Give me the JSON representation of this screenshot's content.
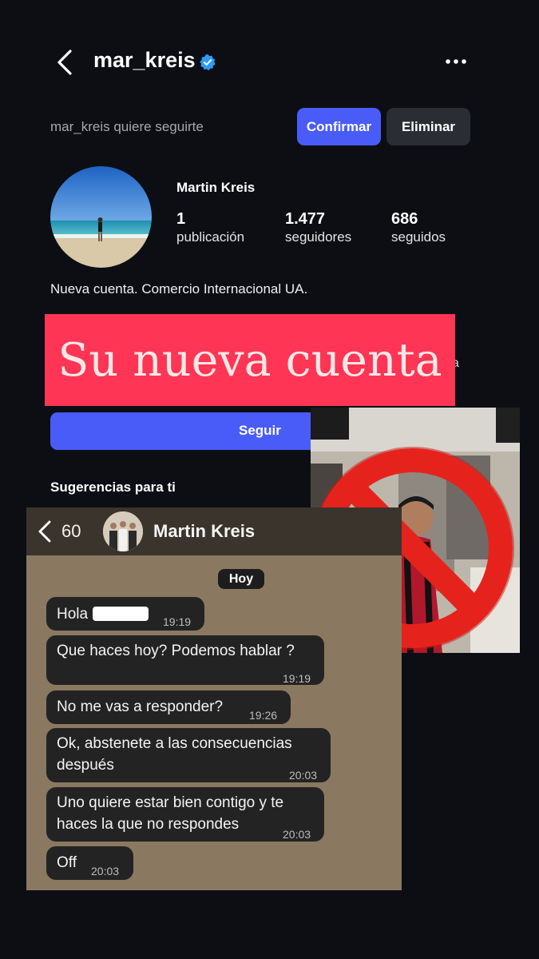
{
  "profile_request": {
    "username": "mar_kreis",
    "request_text": "mar_kreis quiere seguirte",
    "confirm_label": "Confirmar",
    "delete_label": "Eliminar"
  },
  "profile": {
    "full_name": "Martin Kreis",
    "stats": [
      {
        "value": "1",
        "label": "publicación"
      },
      {
        "value": "1.477",
        "label": "seguidores"
      },
      {
        "value": "686",
        "label": "seguidos"
      }
    ],
    "bio": "Nueva cuenta. Comercio Internacional UA.",
    "follow_label": "Seguir",
    "suggestions_label": "Sugerencias para ti",
    "partial_text": "a"
  },
  "banner": {
    "text": "Su nueva cuenta"
  },
  "chat": {
    "back_count": "60",
    "contact_name": "Martin Kreis",
    "day_label": "Hoy",
    "messages": [
      {
        "text": "Hola",
        "time": "19:19"
      },
      {
        "text": "Que haces hoy? Podemos hablar ?",
        "time": "19:19"
      },
      {
        "text": "No me vas a responder?",
        "time": "19:26"
      },
      {
        "line1": "Ok, abstenete a las consecuencias",
        "line2": "después",
        "time": "20:03"
      },
      {
        "line1": "Uno quiere estar bien contigo y te",
        "line2": "haces la que no respondes",
        "time": "20:03"
      },
      {
        "text": "Off",
        "time": "20:03"
      }
    ]
  },
  "colors": {
    "background": "#0c0e14",
    "primary_button": "#4a5cf7",
    "secondary_button": "#2a2d33",
    "banner": "#fe3554",
    "verified_badge": "#2f9bf5",
    "chat_background": "#8a7860",
    "chat_bubble": "#232323",
    "prohibition_sign": "#e5231c"
  },
  "icons": [
    "back-chevron-icon",
    "verified-badge-icon",
    "more-options-icon",
    "prohibition-icon"
  ]
}
